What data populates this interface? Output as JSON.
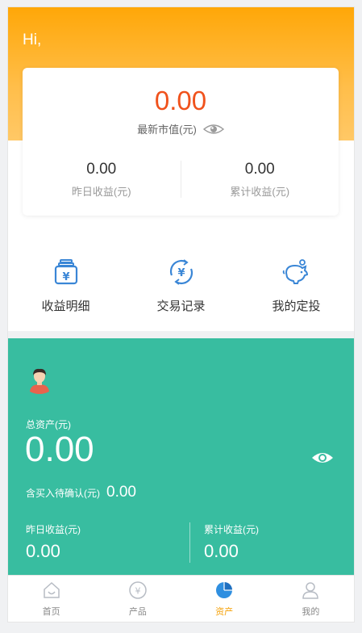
{
  "header": {
    "greeting": "Hi,"
  },
  "market_card": {
    "value": "0.00",
    "label": "最新市值(元)",
    "stats": [
      {
        "value": "0.00",
        "label": "昨日收益(元)"
      },
      {
        "value": "0.00",
        "label": "累计收益(元)"
      }
    ]
  },
  "quick_actions": [
    {
      "label": "收益明细",
      "icon": "money-bag-icon"
    },
    {
      "label": "交易记录",
      "icon": "yuan-refresh-icon"
    },
    {
      "label": "我的定投",
      "icon": "piggy-bank-icon"
    }
  ],
  "assets": {
    "total_label": "总资产(元)",
    "total_value": "0.00",
    "pending_label": "含买入待确认(元)",
    "pending_value": "0.00",
    "yesterday_label": "昨日收益(元)",
    "yesterday_value": "0.00",
    "cumulative_label": "累计收益(元)",
    "cumulative_value": "0.00"
  },
  "tabbar": [
    {
      "label": "首页",
      "icon": "home-icon"
    },
    {
      "label": "产品",
      "icon": "yuan-circle-icon"
    },
    {
      "label": "资产",
      "icon": "pie-chart-icon",
      "active": true
    },
    {
      "label": "我的",
      "icon": "user-icon"
    }
  ],
  "colors": {
    "orange": "#ffa708",
    "red_value": "#f0521c",
    "teal": "#38bda0",
    "icon_blue": "#3a86d6",
    "tab_active": "#f5a20a"
  }
}
